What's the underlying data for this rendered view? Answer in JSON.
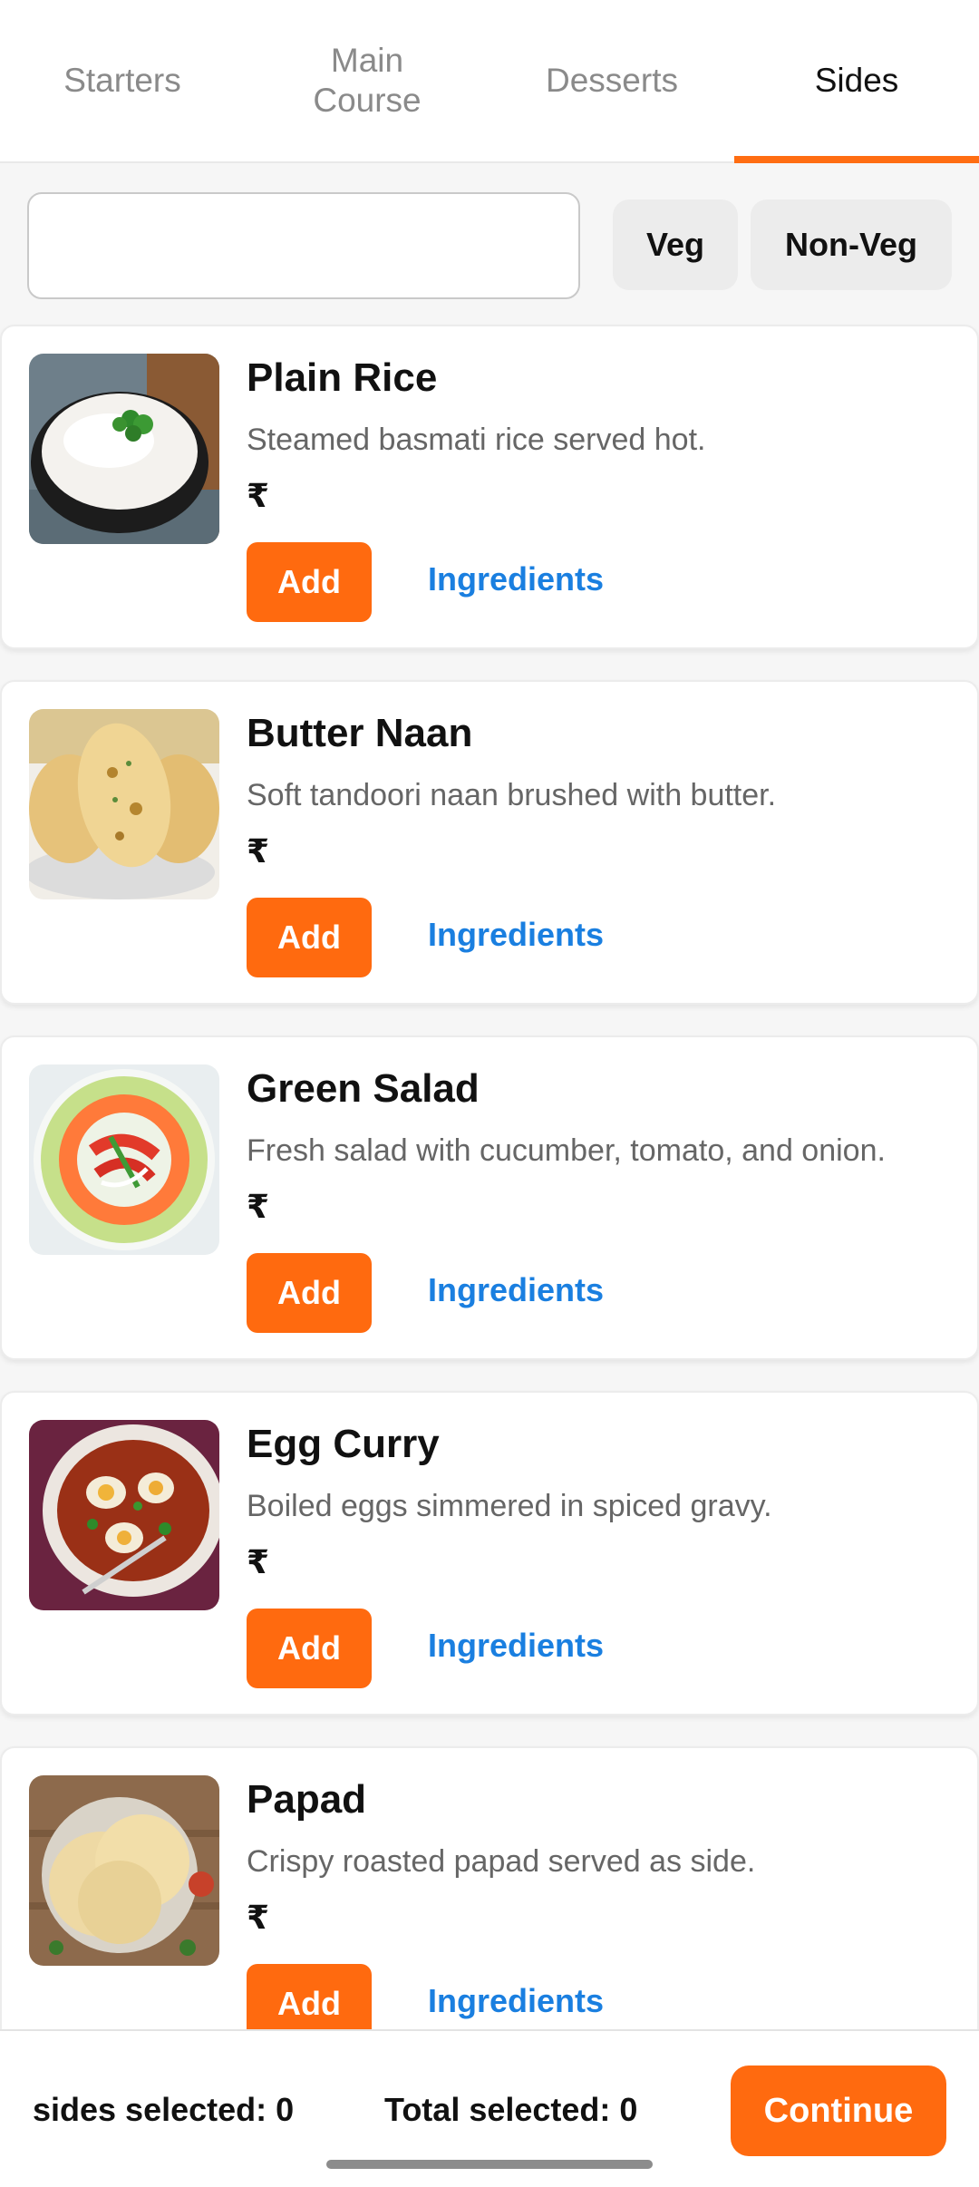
{
  "tabs": [
    {
      "label_line1": "Starters",
      "label_line2": ""
    },
    {
      "label_line1": "Main",
      "label_line2": "Course"
    },
    {
      "label_line1": "Desserts",
      "label_line2": ""
    },
    {
      "label_line1": "Sides",
      "label_line2": ""
    }
  ],
  "active_tab": "Sides",
  "search": {
    "value": "",
    "placeholder": ""
  },
  "filters": {
    "veg_label": "Veg",
    "nonveg_label": "Non-Veg"
  },
  "items": [
    {
      "name": "Plain Rice",
      "description": "Steamed basmati rice served hot.",
      "price": "₹",
      "add_label": "Add",
      "ingredients_label": "Ingredients",
      "image_icon": "rice-bowl-image"
    },
    {
      "name": "Butter Naan",
      "description": "Soft tandoori naan brushed with butter.",
      "price": "₹",
      "add_label": "Add",
      "ingredients_label": "Ingredients",
      "image_icon": "naan-image"
    },
    {
      "name": "Green Salad",
      "description": "Fresh salad with cucumber, tomato, and onion.",
      "price": "₹",
      "add_label": "Add",
      "ingredients_label": "Ingredients",
      "image_icon": "salad-image"
    },
    {
      "name": "Egg Curry",
      "description": "Boiled eggs simmered in spiced gravy.",
      "price": "₹",
      "add_label": "Add",
      "ingredients_label": "Ingredients",
      "image_icon": "egg-curry-image"
    },
    {
      "name": "Papad",
      "description": "Crispy roasted papad served as side.",
      "price": "₹",
      "add_label": "Add",
      "ingredients_label": "Ingredients",
      "image_icon": "papad-image"
    }
  ],
  "footer": {
    "sides_selected": "sides selected: 0",
    "total_selected": "Total selected: 0",
    "continue_label": "Continue"
  },
  "colors": {
    "accent": "#ff6a0f",
    "link": "#1a7fe0",
    "chip_bg": "#ececec"
  }
}
